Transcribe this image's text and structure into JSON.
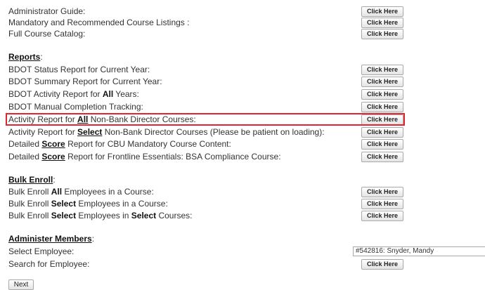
{
  "guides": [
    {
      "label": "Administrator Guide:",
      "button": "Click Here"
    },
    {
      "label": "Mandatory and Recommended Course Listings :",
      "button": "Click Here"
    },
    {
      "label": "Full Course Catalog:",
      "button": "Click Here"
    }
  ],
  "reports": {
    "heading": "Reports",
    "items": [
      {
        "pre": "BDOT Status Report for Current Year:",
        "bold": "",
        "post": "",
        "button": "Click Here"
      },
      {
        "pre": "BDOT Summary Report for Current Year:",
        "bold": "",
        "post": "",
        "button": "Click Here"
      },
      {
        "pre": "BDOT Activity Report for ",
        "bold": "All",
        "post": " Years:",
        "button": "Click Here"
      },
      {
        "pre": "BDOT Manual Completion Tracking:",
        "bold": "",
        "post": "",
        "button": "Click Here"
      },
      {
        "pre": "Activity Report for ",
        "bold": "All",
        "post": " Non-Bank Director Courses:",
        "button": "Click Here"
      },
      {
        "pre": "Activity Report for ",
        "bold": "Select",
        "post": " Non-Bank Director Courses (Please be patient on loading):",
        "button": "Click Here"
      },
      {
        "pre": "Detailed ",
        "bold": "Score",
        "post": " Report for CBU Mandatory Course Content:",
        "button": "Click Here"
      },
      {
        "pre": "Detailed ",
        "bold": "Score",
        "post": " Report for Frontline Essentials: BSA Compliance Course:",
        "button": "Click Here"
      }
    ]
  },
  "bulk_enroll": {
    "heading": "Bulk Enroll",
    "items": [
      {
        "pre": "Bulk Enroll ",
        "bold": "All",
        "mid": " Employees in a Course:",
        "bold2": "",
        "post": "",
        "button": "Click Here"
      },
      {
        "pre": "Bulk Enroll ",
        "bold": "Select",
        "mid": " Employees in a Course:",
        "bold2": "",
        "post": "",
        "button": "Click Here"
      },
      {
        "pre": "Bulk Enroll ",
        "bold": "Select",
        "mid": " Employees in ",
        "bold2": "Select",
        "post": " Courses:",
        "button": "Click Here"
      }
    ]
  },
  "administer_members": {
    "heading": "Administer Members",
    "select_label": "Select Employee:",
    "select_value": "#542816: Snyder, Mandy",
    "search_label": "Search for Employee:",
    "search_button": "Click Here"
  },
  "next_button": "Next",
  "colors": {
    "highlight": "#e0262e"
  }
}
